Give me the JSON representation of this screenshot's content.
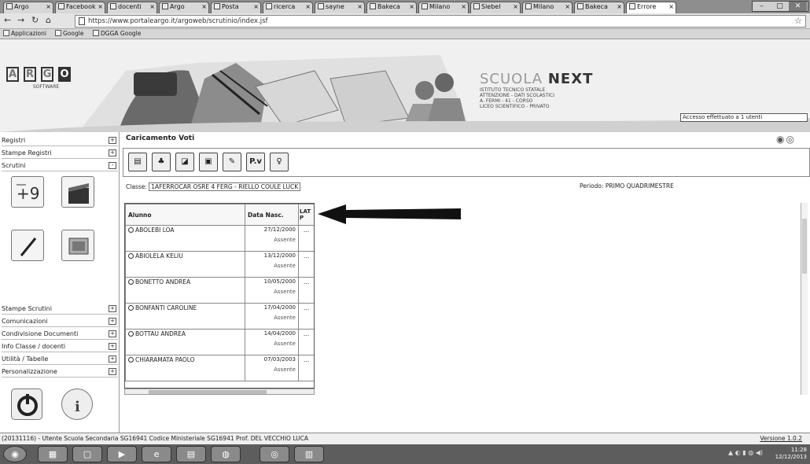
{
  "browser": {
    "tabs": [
      {
        "label": "Argo"
      },
      {
        "label": "Facebook"
      },
      {
        "label": "docenti"
      },
      {
        "label": "Argo"
      },
      {
        "label": "Posta"
      },
      {
        "label": "ricerca"
      },
      {
        "label": "sayne"
      },
      {
        "label": "Bakeca"
      },
      {
        "label": "Milano"
      },
      {
        "label": "Siebel"
      },
      {
        "label": "Milano"
      },
      {
        "label": "Bakeca"
      },
      {
        "label": "Errore"
      }
    ],
    "url": "https://www.portaleargo.it/argoweb/scrutinio/index.jsf",
    "bookmarks": [
      "Applicazioni",
      "Google",
      "DGGA Google"
    ]
  },
  "banner": {
    "logo_letters": [
      "A",
      "R",
      "G",
      "O"
    ],
    "logo_sub": "SOFTWARE",
    "brand_light": "SCUOLA",
    "brand_bold": "NEXT",
    "school_lines": [
      "ISTITUTO TECNICO STATALE",
      "ATTENZIONE - DATI SCOLASTICI",
      "A. FERMI - 41 - CORSO",
      "LICEO SCIENTIFICO - PRIVATO"
    ],
    "session_notice": "Accesso effettuato a 1 utenti"
  },
  "sidebar": {
    "menus_top": [
      {
        "label": "Registri",
        "sign": "+"
      },
      {
        "label": "Stampe Registri",
        "sign": "+"
      },
      {
        "label": "Scrutini",
        "sign": "-"
      }
    ],
    "menus_bottom": [
      {
        "label": "Stampe Scrutini",
        "sign": "+"
      },
      {
        "label": "Comunicazioni",
        "sign": "+"
      },
      {
        "label": "Condivisione Documenti",
        "sign": "+"
      },
      {
        "label": "Info Classe / docenti",
        "sign": "+"
      },
      {
        "label": "Utilità / Tabelle",
        "sign": "+"
      },
      {
        "label": "Personalizzazione",
        "sign": "+"
      }
    ]
  },
  "main": {
    "title": "Caricamento Voti",
    "classe_label": "Classe:",
    "classe_value": "1AFERROCAR OSRE 4 FERG - RIELLO COULE LUCK",
    "periodo_label": "Periodo:",
    "periodo_value": "PRIMO QUADRIMESTRE",
    "grid": {
      "col_name": "Alunno",
      "col_date": "Data Nasc.",
      "col_subject": "LAT P",
      "rows": [
        {
          "name": "ABOLEBI LOA",
          "date": "27/12/2000",
          "status": "Assente",
          "vote": "..."
        },
        {
          "name": "ABIOLELA KELIU",
          "date": "13/12/2000",
          "status": "Assente",
          "vote": "..."
        },
        {
          "name": "BONETTO ANDREA",
          "date": "10/05/2000",
          "status": "Assente",
          "vote": "..."
        },
        {
          "name": "BONFANTI CAROLINE",
          "date": "17/04/2000",
          "status": "Assente",
          "vote": "..."
        },
        {
          "name": "BOTTAU ANDREA",
          "date": "14/04/2000",
          "status": "Assente",
          "vote": "..."
        },
        {
          "name": "CHIARAMATA PAOLO",
          "date": "07/03/2003",
          "status": "Assente",
          "vote": "..."
        }
      ]
    }
  },
  "status": {
    "text": "(20131116) - Utente Scuola Secondaria SG16941 Codice Ministeriale SG16941 Prof. DEL VECCHIO LUCA",
    "version": "Versione 1.0.2"
  },
  "taskbar": {
    "time": "11:28",
    "date": "12/12/2013"
  }
}
